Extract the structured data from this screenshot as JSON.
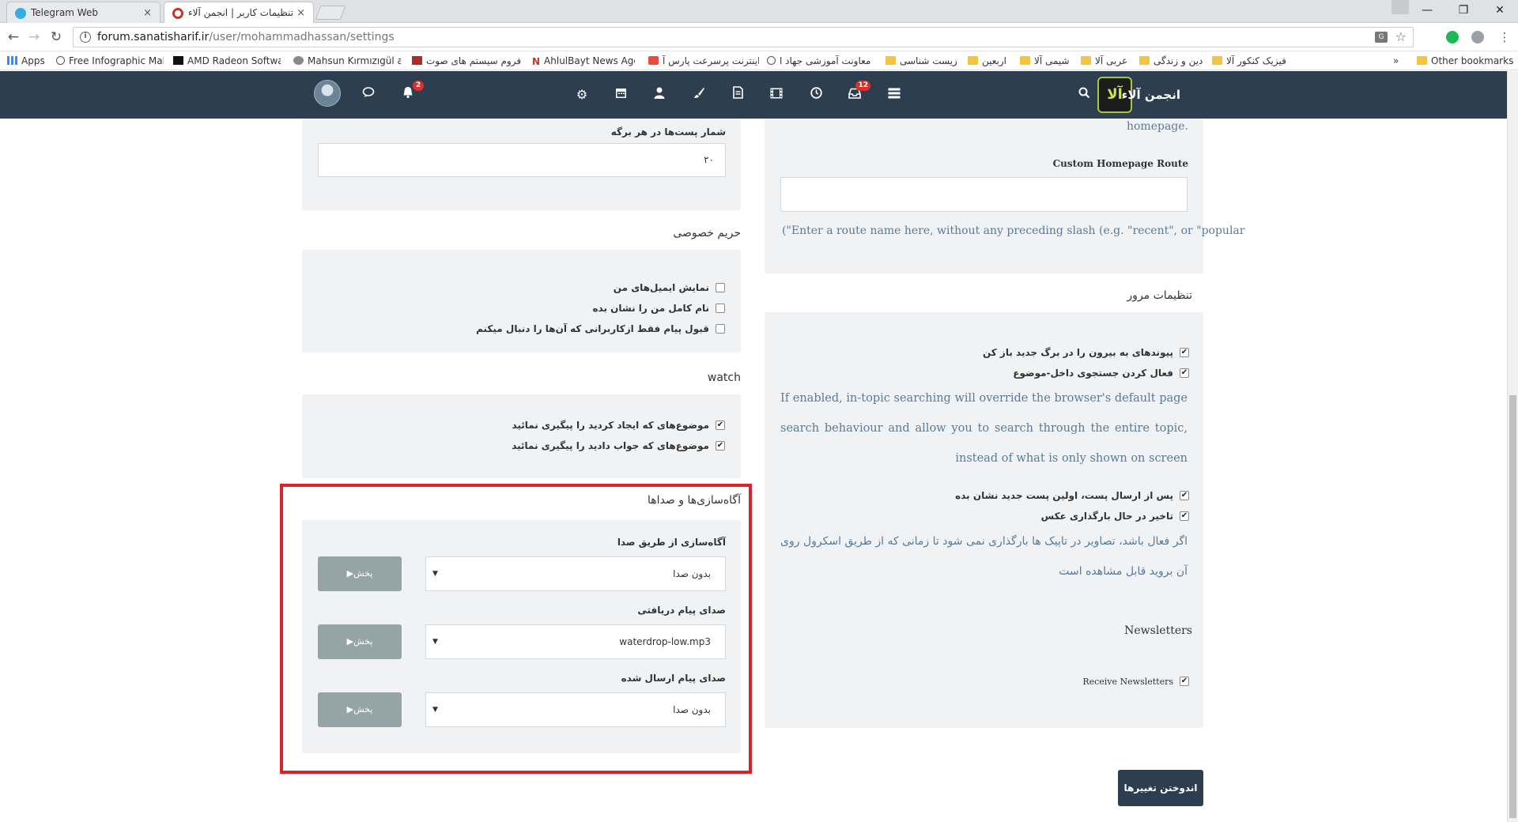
{
  "browser": {
    "tabs": [
      {
        "title": "Telegram Web",
        "close": "×"
      },
      {
        "title": "تنظیمات کاربر | انجمن آلاء",
        "close": "×"
      }
    ],
    "window_controls": {
      "minimize": "—",
      "maximize": "❐",
      "close": "✕"
    },
    "url_host": "forum.sanatisharif.ir",
    "url_path": "/user/mohammadhassan/settings",
    "bookmarks": [
      "Apps",
      "Free Infographic Mak",
      "AMD Radeon Softwar",
      "Mahsun Kırmızıgül alb",
      "فروم سیستم های صوت",
      "AhlulBayt News Agen",
      "اینترنت پرسرعت پارس آ",
      "معاونت آموزشی جهاد ا",
      "زیست شناسی",
      "اربعین",
      "شیمی آلا",
      "عربی آلا",
      "دین و زندگی",
      "فیزیک کنکور آلا"
    ],
    "bookmarks_overflow": "»",
    "other_bookmarks": "Other bookmarks"
  },
  "sitenav": {
    "brand_title": "انجمن آلاء",
    "brand_logo_text": "آلا",
    "notifications_count": "2",
    "inbox_count": "12"
  },
  "left_column": {
    "posts_per_page": {
      "label": "شمار پست‌ها در هر برگه",
      "value": "۲۰"
    },
    "privacy": {
      "title": "حریم خصوصی",
      "items": [
        {
          "label": "نمایش ایمیل‌های من",
          "checked": false
        },
        {
          "label": "نام کامل من را نشان بده",
          "checked": false
        },
        {
          "label": "قبول پیام فقط ازکاربرانی که آن‌ها را دنبال میکنم",
          "checked": false
        }
      ]
    },
    "watch": {
      "title": "watch",
      "items": [
        {
          "label": "موضوع‌های که ایجاد کردید را پیگیری نمائید",
          "checked": true
        },
        {
          "label": "موضوع‌های که جواب دادید را پیگیری نمائید",
          "checked": true
        }
      ]
    },
    "sounds": {
      "title": "آگاه‌سازی‌ها و صداها",
      "rows": [
        {
          "label": "آگاه‌سازی از طریق صدا",
          "value": "بدون صدا",
          "play": "پخش"
        },
        {
          "label": "صدای پیام دریافتی",
          "value": "waterdrop-low.mp3",
          "play": "پخش"
        },
        {
          "label": "صدای پیام ارسال شده",
          "value": "بدون صدا",
          "play": "پخش"
        }
      ]
    }
  },
  "right_column": {
    "homepage_tail": ".homepage",
    "custom_route": {
      "label": "Custom Homepage Route",
      "value": "",
      "hint": "(\"Enter a route name here, without any preceding slash (e.g. \"recent\", or \"popular"
    },
    "browsing": {
      "title": "تنظیمات مرور",
      "items": [
        {
          "label": "پیوندهای به بیرون را در برگ جدید باز کن",
          "checked": true
        },
        {
          "label": "فعال کردن جستجوی داخل-موضوع",
          "checked": true
        }
      ],
      "desc1": "If enabled, in-topic searching will override the browser's default page search behaviour and allow you to search through the entire topic, instead of what is only shown on screen",
      "items2": [
        {
          "label": "پس از ارسال پست، اولین پست جدید نشان بده",
          "checked": true
        },
        {
          "label": "تاخیر در حال بارگذاری عکس",
          "checked": true
        }
      ],
      "desc2": "اگر فعال باشد، تصاویر در تاپیک ها بارگذاری نمی شود تا زمانی که از طریق اسکرول روی آن بروید قابل مشاهده است"
    },
    "newsletters": {
      "title": "Newsletters",
      "item": {
        "label": "Receive Newsletters",
        "checked": true
      }
    }
  },
  "save_button": "اندوختن تغییرها",
  "colors": {
    "navbar": "#2c3e50",
    "highlight": "#d9232b",
    "panel": "#f0f2f4",
    "play_button": "#95a5a6"
  },
  "icons": {
    "nav": [
      "avatar",
      "chat-icon",
      "bell-icon",
      "settings-icon",
      "calendar-icon",
      "user-icon",
      "brush-icon",
      "document-icon",
      "film-icon",
      "clock-icon",
      "inbox-icon",
      "list-icon",
      "search-icon"
    ]
  }
}
